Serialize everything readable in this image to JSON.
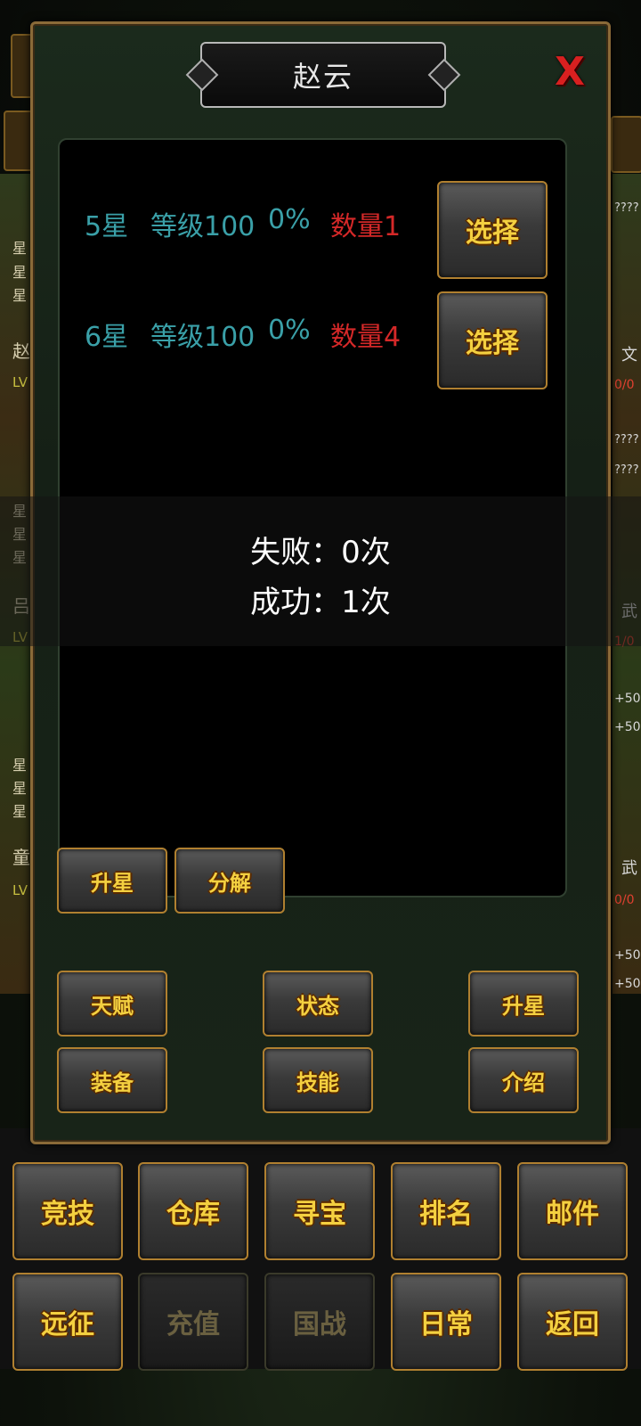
{
  "dialog": {
    "title": "赵云",
    "close_label": "X"
  },
  "star_list": [
    {
      "star": "5星",
      "level": "等级100",
      "percent": "0%",
      "quantity": "数量1",
      "select_label": "选择"
    },
    {
      "star": "6星",
      "level": "等级100",
      "percent": "0%",
      "quantity": "数量4",
      "select_label": "选择"
    }
  ],
  "result": {
    "fail": "失败：0次",
    "success": "成功：1次"
  },
  "action_buttons": {
    "upgrade_star": "升星",
    "decompose": "分解"
  },
  "hero_tabs": {
    "talent": "天赋",
    "status": "状态",
    "star_up": "升星",
    "equipment": "装备",
    "skill": "技能",
    "intro": "介绍"
  },
  "main_menu": {
    "row1": [
      "竞技",
      "仓库",
      "寻宝",
      "排名",
      "邮件"
    ],
    "row2": [
      "远征",
      "充值",
      "国战",
      "日常",
      "返回"
    ]
  },
  "background_list": {
    "left_chars": [
      "星",
      "星",
      "星",
      "赵",
      "LV",
      "星",
      "星",
      "星",
      "吕",
      "LV",
      "星",
      "星",
      "星",
      "童",
      "LV"
    ],
    "right_texts": [
      "????",
      "文",
      "0/0",
      "????",
      "????",
      "武",
      "1/0",
      "+50",
      "+50",
      "武",
      "0/0",
      "+50",
      "+50"
    ]
  },
  "colors": {
    "teal_text": "#3aa0a8",
    "red_text": "#d42828",
    "gold_button_text": "#f4d040",
    "button_border": "#b08030"
  }
}
